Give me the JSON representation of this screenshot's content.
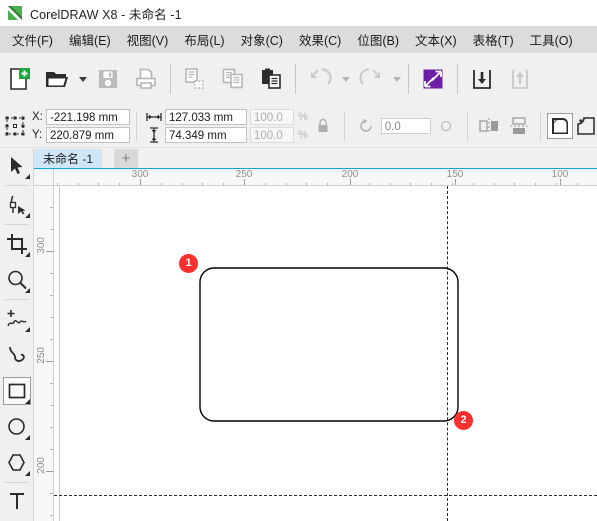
{
  "window": {
    "title": "CorelDRAW X8 - 未命名 -1",
    "logo_icon": "coreldraw-logo-icon"
  },
  "menubar": {
    "items": [
      {
        "label": "文件(F)",
        "text": "文件",
        "mnemonic": "F"
      },
      {
        "label": "编辑(E)",
        "text": "编辑",
        "mnemonic": "E"
      },
      {
        "label": "视图(V)",
        "text": "视图",
        "mnemonic": "V"
      },
      {
        "label": "布局(L)",
        "text": "布局",
        "mnemonic": "L"
      },
      {
        "label": "对象(C)",
        "text": "对象",
        "mnemonic": "C"
      },
      {
        "label": "效果(C)",
        "text": "效果",
        "mnemonic": "C"
      },
      {
        "label": "位图(B)",
        "text": "位图",
        "mnemonic": "B"
      },
      {
        "label": "文本(X)",
        "text": "文本",
        "mnemonic": "X"
      },
      {
        "label": "表格(T)",
        "text": "表格",
        "mnemonic": "T"
      },
      {
        "label": "工具(O)",
        "text": "工具",
        "mnemonic": "O"
      }
    ]
  },
  "toolbar": {
    "buttons": [
      {
        "name": "new-document-button",
        "icon": "new-document-icon",
        "enabled": true
      },
      {
        "name": "open-document-button",
        "icon": "open-folder-icon",
        "enabled": true,
        "has_dropdown": true
      },
      {
        "name": "save-button",
        "icon": "save-floppy-icon",
        "enabled": false
      },
      {
        "name": "print-button",
        "icon": "print-icon",
        "enabled": false
      },
      {
        "name": "cut-button",
        "icon": "cut-icon",
        "enabled": false
      },
      {
        "name": "copy-button",
        "icon": "copy-icon",
        "enabled": false
      },
      {
        "name": "paste-button",
        "icon": "paste-icon",
        "enabled": true
      },
      {
        "name": "undo-button",
        "icon": "undo-arrow-icon",
        "enabled": false,
        "has_dropdown": true
      },
      {
        "name": "redo-button",
        "icon": "redo-arrow-icon",
        "enabled": false,
        "has_dropdown": true
      },
      {
        "name": "import-button",
        "icon": "import-icon",
        "enabled": true
      },
      {
        "name": "export-button",
        "icon": "export-down-arrow-icon",
        "enabled": true
      }
    ],
    "import_icon_color": "#6f1ea6"
  },
  "propertybar": {
    "object_icon": "object-position-icon",
    "x_label": "X:",
    "y_label": "Y:",
    "x_value": "-221.198 mm",
    "y_value": "220.879 mm",
    "width_value": "127.033 mm",
    "height_value": "74.349 mm",
    "scale_x": "100.0",
    "scale_y": "100.0",
    "percent_sign": "%",
    "lock_icon": "lock-ratio-icon",
    "rotation_icon": "rotation-icon",
    "rotation_value": "0.0",
    "anchor_icon": "anchor-circle-icon",
    "mirror_h_icon": "mirror-horizontal-icon",
    "mirror_v_icon": "mirror-vertical-icon",
    "corner_buttons": [
      {
        "name": "round-corner-button",
        "icon": "round-corner-icon",
        "selected": true
      },
      {
        "name": "scallop-corner-button",
        "icon": "scallop-corner-icon",
        "selected": false
      },
      {
        "name": "chamfer-corner-button",
        "icon": "chamfer-corner-icon",
        "selected": false
      }
    ]
  },
  "tabstrip": {
    "active_tab": "未命名 -1",
    "add_tab_label": "+",
    "accent_color": "#14a3e0"
  },
  "toolbox": {
    "tools": [
      {
        "name": "pick-tool",
        "icon": "arrow-cursor-icon",
        "active": false,
        "flyout": true,
        "sep_after": true
      },
      {
        "name": "shape-tool",
        "icon": "shape-node-icon",
        "active": false,
        "flyout": true,
        "sep_after": true
      },
      {
        "name": "crop-tool",
        "icon": "crop-icon",
        "active": false,
        "flyout": true,
        "sep_after": false
      },
      {
        "name": "zoom-tool",
        "icon": "magnifier-icon",
        "active": false,
        "flyout": true,
        "sep_after": true
      },
      {
        "name": "freehand-tool",
        "icon": "freehand-curve-icon",
        "active": false,
        "flyout": true,
        "sep_after": false
      },
      {
        "name": "artistic-media-tool",
        "icon": "artistic-media-icon",
        "active": false,
        "flyout": false,
        "sep_after": false
      },
      {
        "name": "rectangle-tool",
        "icon": "rectangle-icon",
        "active": true,
        "flyout": true,
        "sep_after": false
      },
      {
        "name": "ellipse-tool",
        "icon": "ellipse-icon",
        "active": false,
        "flyout": true,
        "sep_after": false
      },
      {
        "name": "polygon-tool",
        "icon": "polygon-icon",
        "active": false,
        "flyout": true,
        "sep_after": true
      },
      {
        "name": "text-tool",
        "icon": "text-tool-icon",
        "active": false,
        "flyout": false,
        "sep_after": false
      }
    ]
  },
  "rulers": {
    "unit": "mm",
    "horizontal_labels": [
      "300",
      "250",
      "200",
      "150",
      "100"
    ],
    "vertical_labels": [
      "300",
      "250",
      "200"
    ]
  },
  "canvas": {
    "shape": {
      "name": "rounded-rectangle",
      "stroke_color": "#000000",
      "fill": "none",
      "corner_radius": 14
    },
    "markers": [
      {
        "label": "1",
        "name": "annotation-marker-1",
        "color": "#f9302e"
      },
      {
        "label": "2",
        "name": "annotation-marker-2",
        "color": "#f9302e"
      }
    ]
  }
}
